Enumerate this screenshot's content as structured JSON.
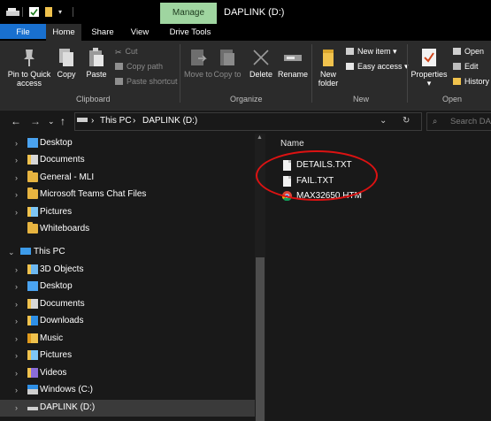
{
  "window": {
    "title": "DAPLINK (D:)",
    "manage_tab": "Manage"
  },
  "tabs": [
    "File",
    "Home",
    "Share",
    "View",
    "Drive Tools"
  ],
  "ribbon": {
    "pin_label": "Pin to Quick access",
    "copy_label": "Copy",
    "paste_label": "Paste",
    "cut_label": "Cut",
    "copy_path_label": "Copy path",
    "paste_shortcut_label": "Paste shortcut",
    "clipboard_group": "Clipboard",
    "move_to_label": "Move to",
    "copy_to_label": "Copy to",
    "delete_label": "Delete",
    "rename_label": "Rename",
    "organize_group": "Organize",
    "new_folder_label": "New folder",
    "new_item_label": "New item",
    "easy_access_label": "Easy access",
    "new_group": "New",
    "properties_label": "Properties",
    "open_label": "Open",
    "edit_label": "Edit",
    "history_label": "History",
    "open_group": "Open"
  },
  "address": {
    "crumb_1": "This PC",
    "crumb_2": "DAPLINK (D:)",
    "search_placeholder": "Search DA"
  },
  "nav_items": [
    {
      "label": "Desktop",
      "icon": "desktop-icon"
    },
    {
      "label": "Documents",
      "icon": "documents-icon"
    },
    {
      "label": "General - MLI",
      "icon": "folder-icon"
    },
    {
      "label": "Microsoft Teams Chat Files",
      "icon": "folder-icon"
    },
    {
      "label": "Pictures",
      "icon": "pictures-icon"
    },
    {
      "label": "Whiteboards",
      "icon": "folder-icon"
    },
    {
      "label": "This PC",
      "icon": "this-pc-icon"
    },
    {
      "label": "3D Objects",
      "icon": "3d-objects-icon"
    },
    {
      "label": "Desktop",
      "icon": "desktop-icon"
    },
    {
      "label": "Documents",
      "icon": "documents-icon"
    },
    {
      "label": "Downloads",
      "icon": "downloads-icon"
    },
    {
      "label": "Music",
      "icon": "music-icon"
    },
    {
      "label": "Pictures",
      "icon": "pictures-icon"
    },
    {
      "label": "Videos",
      "icon": "videos-icon"
    },
    {
      "label": "Windows (C:)",
      "icon": "windows-drive-icon"
    },
    {
      "label": "DAPLINK (D:)",
      "icon": "usb-drive-icon"
    }
  ],
  "content": {
    "column_header": "Name",
    "files": [
      {
        "name": "DETAILS.TXT",
        "icon": "text-file-icon"
      },
      {
        "name": "FAIL.TXT",
        "icon": "text-file-icon"
      },
      {
        "name": "MAX32650.HTM",
        "icon": "chrome-icon"
      }
    ]
  },
  "colors": {
    "accent": "#1970cf",
    "manage": "#9fd5a0",
    "annotation": "#dc1212"
  }
}
